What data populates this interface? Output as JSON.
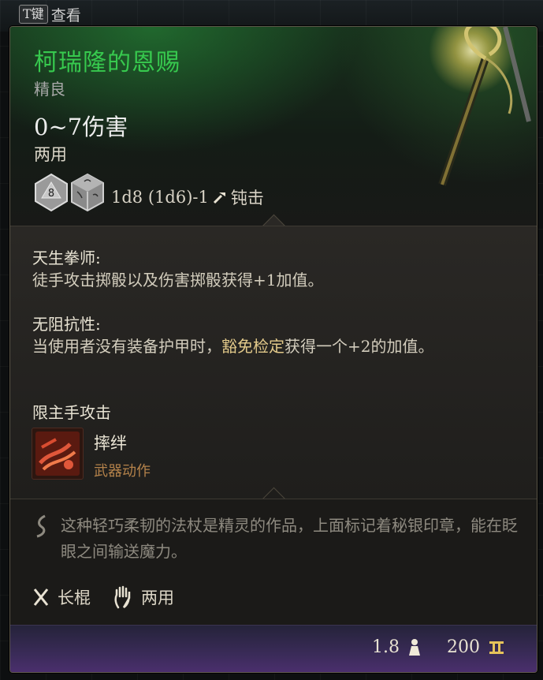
{
  "hint": {
    "key": "T键",
    "label": "查看"
  },
  "item": {
    "name": "柯瑞隆的恩赐",
    "rarity": "精良",
    "damage": "0~7伤害",
    "handedness": "两用",
    "dice_value": "8",
    "dice_formula": "1d8 (1d6)-1",
    "damage_type": "钝击"
  },
  "features": [
    {
      "title": "天生拳师:",
      "desc": "徒手攻击掷骰以及伤害掷骰获得+1加值。"
    },
    {
      "title": "无阻抗性:",
      "desc_pre": "当使用者没有装备护甲时，",
      "desc_hl": "豁免检定",
      "desc_post": "获得一个+2的加值。"
    }
  ],
  "mainhand_label": "限主手攻击",
  "action": {
    "name": "摔绊",
    "type": "武器动作"
  },
  "lore": "这种轻巧柔韧的法杖是精灵的作品，上面标记着秘银印章，能在眨眼之间输送魔力。",
  "tags": [
    {
      "icon": "quarterstaff-icon",
      "label": "长棍"
    },
    {
      "icon": "hand-icon",
      "label": "两用"
    }
  ],
  "footer": {
    "weight": "1.8",
    "value": "200"
  },
  "colors": {
    "name": "#37c94e",
    "action_type": "#b4824a",
    "footer": "#4b2f6e"
  }
}
